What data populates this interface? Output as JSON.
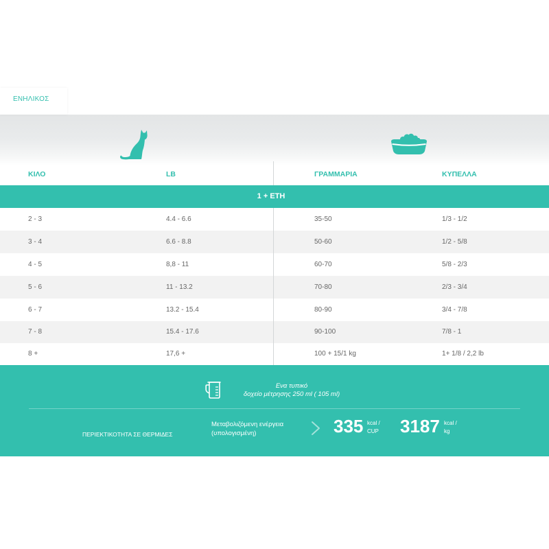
{
  "tabs": [
    {
      "label": "ΕΝΗΛΙΚΟΣ"
    }
  ],
  "colors": {
    "accent": "#33bfae",
    "text": "#666666",
    "row_alt": "#f2f2f2",
    "header_gray": "#e3e5e6"
  },
  "icons": {
    "weight": "cat-icon",
    "portion": "bowl-icon",
    "measure": "measuring-cup-icon",
    "arrow": "chevron-right-icon"
  },
  "table": {
    "headers": {
      "kilo": "ΚΙΛΟ",
      "lb": "LB",
      "grams": "ΓΡΑΜΜΑΡΙΑ",
      "cups": "ΚΥΠΕΛΛΑ"
    },
    "group_label": "1 + ΕΤΗ",
    "rows": [
      {
        "kilo": "2 - 3",
        "lb": "4.4 - 6.6",
        "grams": "35-50",
        "cups": "1/3 - 1/2"
      },
      {
        "kilo": "3 - 4",
        "lb": "6.6 - 8.8",
        "grams": "50-60",
        "cups": "1/2 - 5/8"
      },
      {
        "kilo": "4 - 5",
        "lb": "8,8 - 11",
        "grams": "60-70",
        "cups": "5/8 - 2/3"
      },
      {
        "kilo": "5 - 6",
        "lb": "11 - 13.2",
        "grams": "70-80",
        "cups": "2/3 - 3/4"
      },
      {
        "kilo": "6 - 7",
        "lb": "13.2 - 15.4",
        "grams": "80-90",
        "cups": "3/4 - 7/8"
      },
      {
        "kilo": "7 - 8",
        "lb": "15.4 - 17.6",
        "grams": "90-100",
        "cups": "7/8 - 1"
      },
      {
        "kilo": "8 +",
        "lb": "17,6 +",
        "grams": "100 + 15/1 kg",
        "cups": "1+ 1/8 / 2,2 lb"
      }
    ]
  },
  "measure": {
    "line1": "Ενα τυπικό",
    "line2": "δοχείο μέτρησης 250 ml ( 105 ml)"
  },
  "calories": {
    "label": "ΠΕΡΙΕΚΤΙΚΟΤΗΤΑ ΣΕ ΘΕΡΜΙΔΕΣ",
    "energy_line1": "Μεταβολιζόμενη ενέργεια",
    "energy_line2": "(υπολογισμένη)",
    "per_cup": {
      "value": "335",
      "unit_line1": "kcal /",
      "unit_line2": "CUP"
    },
    "per_kg": {
      "value": "3187",
      "unit_line1": "kcal /",
      "unit_line2": "kg"
    }
  }
}
